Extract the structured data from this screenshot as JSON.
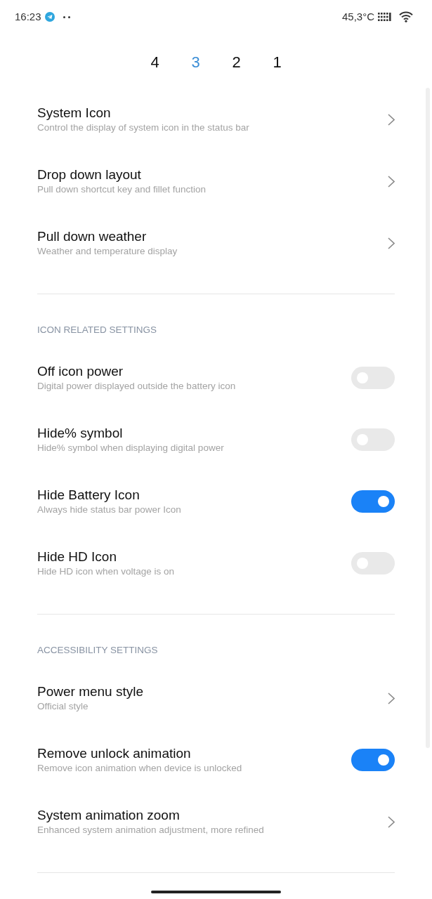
{
  "status_bar": {
    "time": "16:23",
    "temperature": "45,3°C"
  },
  "tabs": [
    {
      "label": "4",
      "selected": false
    },
    {
      "label": "3",
      "selected": true
    },
    {
      "label": "2",
      "selected": false
    },
    {
      "label": "1",
      "selected": false
    }
  ],
  "sections": [
    {
      "items": [
        {
          "kind": "link",
          "title": "System Icon",
          "subtitle": "Control the display of system icon in the status bar"
        },
        {
          "kind": "link",
          "title": "Drop down layout",
          "subtitle": "Pull down shortcut key and fillet function"
        },
        {
          "kind": "link",
          "title": "Pull down weather",
          "subtitle": "Weather and temperature display"
        }
      ]
    },
    {
      "header": "ICON RELATED SETTINGS",
      "items": [
        {
          "kind": "switch",
          "title": "Off icon power",
          "subtitle": "Digital power displayed outside the battery icon",
          "on": false
        },
        {
          "kind": "switch",
          "title": "Hide% symbol",
          "subtitle": "Hide% symbol when displaying digital power",
          "on": false
        },
        {
          "kind": "switch",
          "title": "Hide Battery Icon",
          "subtitle": "Always hide status bar power Icon",
          "on": true
        },
        {
          "kind": "switch",
          "title": "Hide HD Icon",
          "subtitle": "Hide HD icon when voltage is on",
          "on": false
        }
      ]
    },
    {
      "header": "ACCESSIBILITY SETTINGS",
      "items": [
        {
          "kind": "link",
          "title": "Power menu style",
          "subtitle": "Official style"
        },
        {
          "kind": "switch",
          "title": "Remove unlock animation",
          "subtitle": "Remove icon animation when device is unlocked",
          "on": true
        },
        {
          "kind": "link",
          "title": "System animation zoom",
          "subtitle": "Enhanced system animation adjustment, more refined"
        }
      ]
    }
  ]
}
